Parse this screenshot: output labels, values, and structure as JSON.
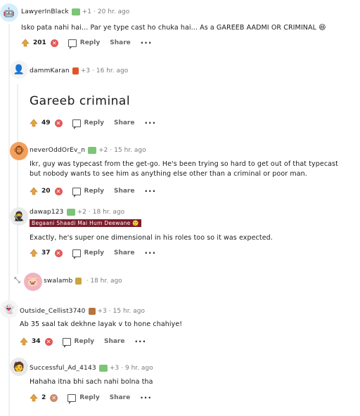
{
  "comments": [
    {
      "user": "LawyerInBlack",
      "flair": "+1",
      "time": "20 hr. ago",
      "body": "Isko pata nahi hai... Par ye type cast ho chuka hai... As a GAREEB AADMI OR CRIMINAL",
      "score": "201",
      "reply": "Reply",
      "share": "Share",
      "more": "···"
    },
    {
      "user": "dammKaran",
      "flair": "+3",
      "time": "16 hr. ago",
      "body": "Gareeb criminal",
      "score": "49",
      "reply": "Reply",
      "share": "Share",
      "more": "···"
    },
    {
      "user": "neverOddOrEv_n",
      "flair": "+2",
      "time": "15 hr. ago",
      "body_lines": [
        "Ikr, guy was typecast from the get-go. He's been trying so hard to get out of that typecast",
        "but nobody wants to see him as anything else other than a criminal or poor man."
      ],
      "score": "20",
      "reply": "Reply",
      "share": "Share",
      "more": "···"
    },
    {
      "user": "dawap123",
      "flair": "+2",
      "time": "18 hr. ago",
      "user_flair_text": "Begaani Shaadi Mai Hum Deewane",
      "body": "Exactly, he's super one dimensional in his roles too so it was expected.",
      "score": "37",
      "reply": "Reply",
      "share": "Share",
      "more": "···"
    },
    {
      "user": "swalamb",
      "time": "18 hr. ago",
      "collapsed": true
    },
    {
      "user": "Outside_Cellist3740",
      "flair": "+3",
      "time": "15 hr. ago",
      "body": "Ab 35 saal tak dekhne layak v to hone chahiye!",
      "score": "34",
      "reply": "Reply",
      "share": "Share",
      "more": "···"
    },
    {
      "user": "Successful_Ad_4143",
      "flair": "+3",
      "time": "9 hr. ago",
      "body": "Hahaha itna bhi sach nahi bolna tha",
      "score": "2",
      "reply": "Reply",
      "share": "Share",
      "more": "···"
    }
  ],
  "separator": "·",
  "colors": {
    "upvote": "#e8a33d",
    "downvote": "#e05a5a",
    "thread_line": "#edeff1",
    "user_flair_bg": "#7c1d2b"
  }
}
